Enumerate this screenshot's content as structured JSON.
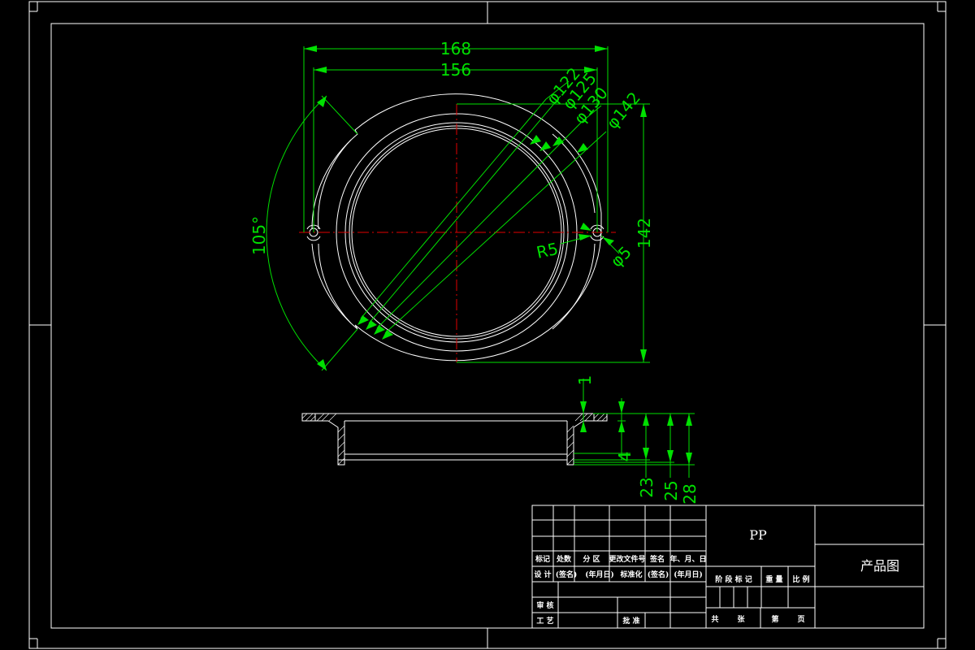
{
  "drawing": {
    "material": "PP",
    "drawing_title": "产品图"
  },
  "dimensions": {
    "top_view": {
      "width_outer": "168",
      "width_inner": "156",
      "dia_122": "φ122",
      "dia_125": "φ125",
      "dia_130": "φ130",
      "dia_142": "φ142",
      "height": "142",
      "angle": "105°",
      "radius": "R5",
      "hole_dia": "φ5"
    },
    "section_view": {
      "d1": "1",
      "d4": "4",
      "d23": "23",
      "d25": "25",
      "d28": "28"
    }
  },
  "title_block": {
    "row_labels": {
      "mark": "标记",
      "count": "处数",
      "zone": "分 区",
      "change_doc": "更改文件号",
      "sign": "签名",
      "date": "年、月、日",
      "design": "设 计",
      "sign_name": "(签名)",
      "ymd1": "(年月日)",
      "standardize": "标准化",
      "signee": "(签名)",
      "ymd2": "(年月日)",
      "review": "审 核",
      "process": "工 艺",
      "approve": "批 准"
    },
    "stage_labels": {
      "stage_mark": "阶 段 标 记",
      "weight": "重 量",
      "scale": "比 例"
    },
    "sheet_labels": {
      "total": "共",
      "sheets": "张",
      "page_no": "第",
      "page": "页"
    }
  },
  "colors": {
    "background": "#000000",
    "geometry": "#ffffff",
    "dimension": "#00e000",
    "centerline": "#e00000"
  }
}
